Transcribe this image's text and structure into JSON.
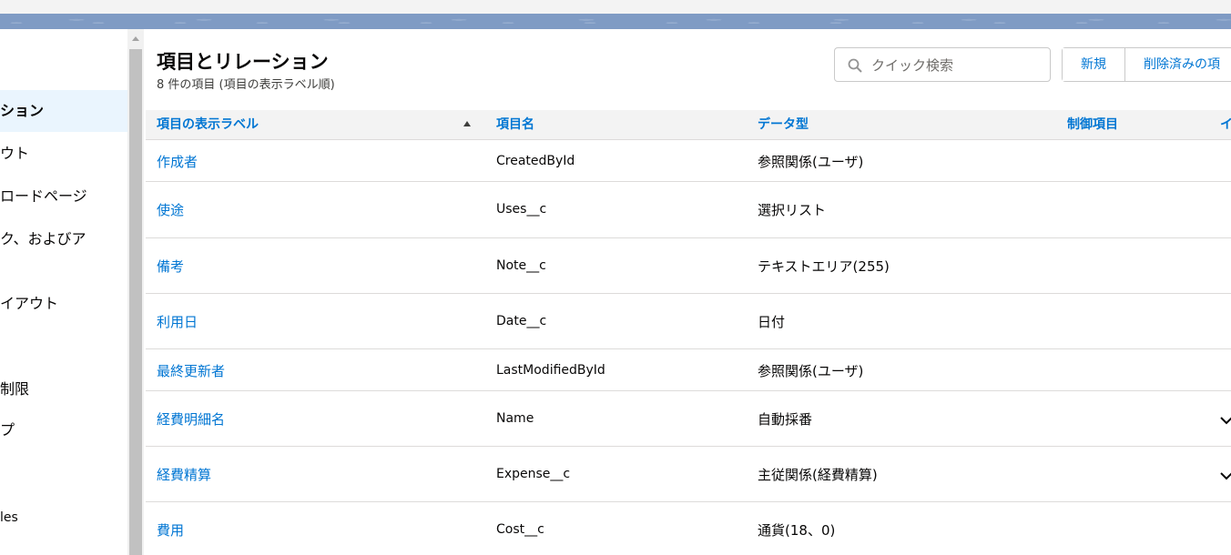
{
  "sidebar": {
    "items": [
      {
        "label": "ション",
        "active": true
      },
      {
        "label": "ウト",
        "active": false
      },
      {
        "label": "ロードページ",
        "active": false
      },
      {
        "label": "ク、およびア",
        "active": false
      },
      {
        "label": "イアウト",
        "active": false
      },
      {
        "label": "制限",
        "active": false
      },
      {
        "label": "プ",
        "active": false
      },
      {
        "label": "les",
        "active": false
      }
    ]
  },
  "header": {
    "title": "項目とリレーション",
    "subtitle": "8 件の項目 (項目の表示ラベル順)"
  },
  "search": {
    "placeholder": "クイック検索",
    "icon": "search-icon"
  },
  "buttons": {
    "new_label": "新規",
    "deleted_label": "削除済みの項"
  },
  "table": {
    "columns": [
      "項目の表示ラベル",
      "項目名",
      "データ型",
      "制御項目",
      "イ"
    ],
    "sort_column": "項目の表示ラベル",
    "sort_direction": "ascending",
    "rows": [
      {
        "label": "作成者",
        "api_name": "CreatedById",
        "type": "参照関係(ユーザ)",
        "dropdown": false
      },
      {
        "label": "使途",
        "api_name": "Uses__c",
        "type": "選択リスト",
        "dropdown": false
      },
      {
        "label": "備考",
        "api_name": "Note__c",
        "type": "テキストエリア(255)",
        "dropdown": false
      },
      {
        "label": "利用日",
        "api_name": "Date__c",
        "type": "日付",
        "dropdown": false
      },
      {
        "label": "最終更新者",
        "api_name": "LastModifiedById",
        "type": "参照関係(ユーザ)",
        "dropdown": false
      },
      {
        "label": "経費明細名",
        "api_name": "Name",
        "type": "自動採番",
        "dropdown": true
      },
      {
        "label": "経費精算",
        "api_name": "Expense__c",
        "type": "主従関係(経費精算)",
        "dropdown": true
      },
      {
        "label": "費用",
        "api_name": "Cost__c",
        "type": "通貨(18、0)",
        "dropdown": false
      }
    ]
  },
  "colors": {
    "link": "#0176d3",
    "header_band": "#7f9bc4",
    "active_item_bg": "#eaf5fe",
    "table_header_bg": "#f3f3f3"
  }
}
